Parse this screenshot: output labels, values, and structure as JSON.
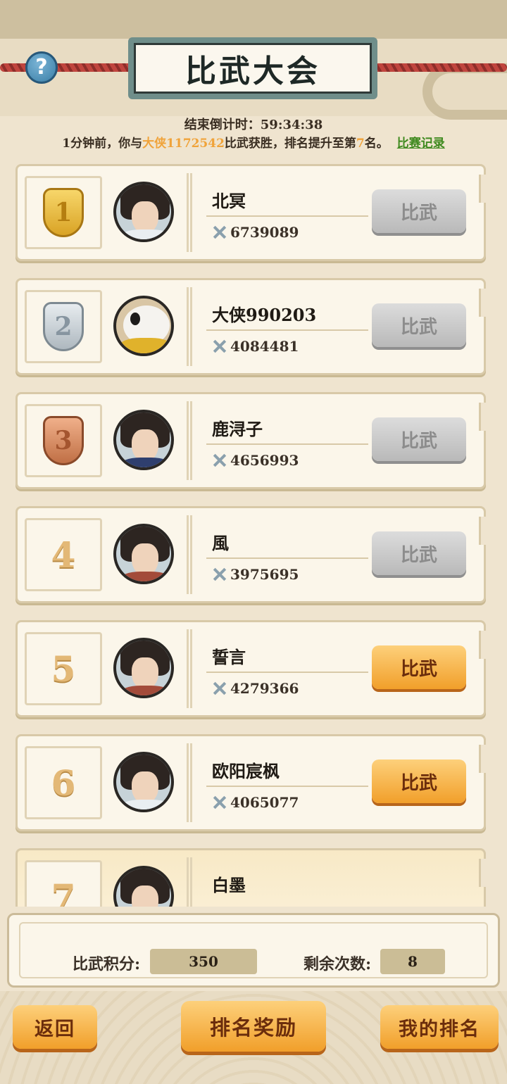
{
  "header": {
    "title": "比武大会",
    "help_icon": "?",
    "countdown": "结束倒计时：59:34:38",
    "recent": {
      "prefix": "1分钟前，你与",
      "opponent": "大侠1172542",
      "middle": "比武获胜，排名提升至第",
      "rank": "7",
      "suffix": "名。",
      "records_link": "比赛记录"
    }
  },
  "players": [
    {
      "rank": "1",
      "medal": "gold",
      "name": "北冥",
      "power": "6739089",
      "button": "比武",
      "enabled": false,
      "avatar": "hero"
    },
    {
      "rank": "2",
      "medal": "silver",
      "name": "大侠990203",
      "power": "4084481",
      "button": "比武",
      "enabled": false,
      "avatar": "panda"
    },
    {
      "rank": "3",
      "medal": "bronze",
      "name": "鹿浔子",
      "power": "4656993",
      "button": "比武",
      "enabled": false,
      "avatar": "dark"
    },
    {
      "rank": "4",
      "medal": "",
      "name": "風",
      "power": "3975695",
      "button": "比武",
      "enabled": false,
      "avatar": "warrior"
    },
    {
      "rank": "5",
      "medal": "",
      "name": "誓言",
      "power": "4279366",
      "button": "比武",
      "enabled": true,
      "avatar": "warrior"
    },
    {
      "rank": "6",
      "medal": "",
      "name": "欧阳宸枫",
      "power": "4065077",
      "button": "比武",
      "enabled": true,
      "avatar": "hero"
    },
    {
      "rank": "7",
      "medal": "",
      "name": "白墨",
      "power": "",
      "button": "",
      "enabled": false,
      "avatar": "hero",
      "is_me": true
    }
  ],
  "stats": {
    "points_label": "比武积分:",
    "points_value": "350",
    "remaining_label": "剩余次数:",
    "remaining_value": "8"
  },
  "buttons": {
    "back": "返回",
    "rank_reward": "排名奖励",
    "my_rank": "我的排名"
  }
}
